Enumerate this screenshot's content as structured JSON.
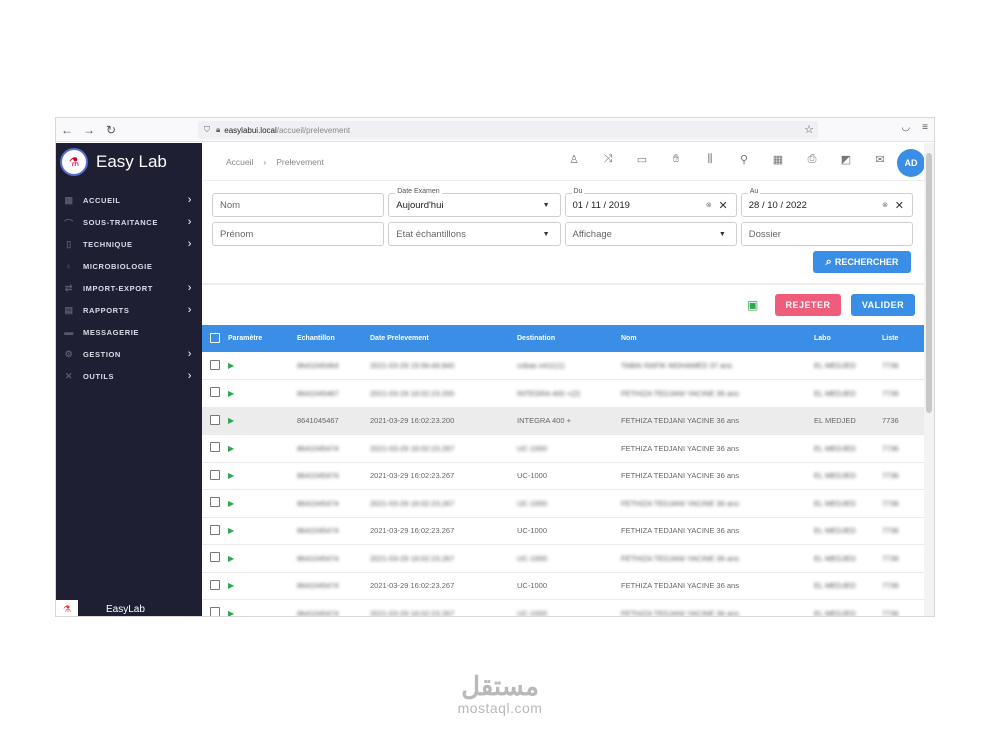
{
  "browser": {
    "url_host": "easylabui.local",
    "url_path": "/accueil/prelevement"
  },
  "sidebar": {
    "app_name": "Easy Lab",
    "items": [
      {
        "label": "ACCUEIL",
        "icon": "grid-icon",
        "chevron": true
      },
      {
        "label": "SOUS-TRAITANCE",
        "icon": "handshake-icon",
        "chevron": true
      },
      {
        "label": "TECHNIQUE",
        "icon": "flask-icon",
        "chevron": true
      },
      {
        "label": "MICROBIOLOGIE",
        "icon": "microscope-icon",
        "chevron": false
      },
      {
        "label": "IMPORT-EXPORT",
        "icon": "transfer-icon",
        "chevron": true
      },
      {
        "label": "RAPPORTS",
        "icon": "report-icon",
        "chevron": true
      },
      {
        "label": "MESSAGERIE",
        "icon": "message-icon",
        "chevron": false
      },
      {
        "label": "GESTION",
        "icon": "gear-icon",
        "chevron": true
      },
      {
        "label": "OUTILS",
        "icon": "tools-icon",
        "chevron": true
      }
    ],
    "footer_label": "EasyLab"
  },
  "header": {
    "breadcrumb": [
      "Accueil",
      "Prelevement"
    ],
    "avatar_initials": "AD"
  },
  "filters": {
    "nom_placeholder": "Nom",
    "date_examen_label": "Date Examen",
    "date_examen_value": "Aujourd'hui",
    "du_label": "Du",
    "du_value": "01 / 11 / 2019",
    "au_label": "Au",
    "au_value": "28 / 10 / 2022",
    "prenom_placeholder": "Prénom",
    "etat_placeholder": "Etat échantillons",
    "affichage_placeholder": "Affichage",
    "dossier_placeholder": "Dossier",
    "search_label": "RECHERCHER"
  },
  "actions": {
    "reject_label": "REJETER",
    "validate_label": "VALIDER"
  },
  "table": {
    "columns": [
      "Paramètre",
      "Echantillon",
      "Date Prelevement",
      "Destination",
      "Nom",
      "Labo",
      "Liste"
    ],
    "rows": [
      {
        "echantillon": "8641045464",
        "date": "2021-03-29 15:56:49.840",
        "destination": "cobas e411(1)",
        "nom": "TABAI RAFIK MOHAMED 37 ans",
        "labo": "EL MEDJED",
        "liste": "7736"
      },
      {
        "echantillon": "8641045467",
        "date": "2021-03-29 16:02:23.200",
        "destination": "INTEGRA 400 +(2)",
        "nom": "FETHIZA TEDJANI YACINE 36 ans",
        "labo": "EL MEDJED",
        "liste": "7736"
      },
      {
        "echantillon": "8641045467",
        "date": "2021-03-29 16:02:23.200",
        "destination": "INTEGRA 400 +",
        "nom": "FETHIZA TEDJANI YACINE 36 ans",
        "labo": "EL MEDJED",
        "liste": "7736"
      },
      {
        "echantillon": "8641045474",
        "date": "2021-03-29 16:02:23.267",
        "destination": "UC-1000",
        "nom": "FETHIZA TEDJANI YACINE 36 ans",
        "labo": "EL MEDJED",
        "liste": "7736"
      },
      {
        "echantillon": "8641045474",
        "date": "2021-03-29 16:02:23.267",
        "destination": "UC-1000",
        "nom": "FETHIZA TEDJANI YACINE 36 ans",
        "labo": "EL MEDJED",
        "liste": "7736"
      },
      {
        "echantillon": "8641045474",
        "date": "2021-03-29 16:02:23.267",
        "destination": "UC-1000",
        "nom": "FETHIZA TEDJANI YACINE 36 ans",
        "labo": "EL MEDJED",
        "liste": "7736"
      },
      {
        "echantillon": "8641045474",
        "date": "2021-03-29 16:02:23.267",
        "destination": "UC-1000",
        "nom": "FETHIZA TEDJANI YACINE 36 ans",
        "labo": "EL MEDJED",
        "liste": "7736"
      },
      {
        "echantillon": "8641045474",
        "date": "2021-03-29 16:02:23.267",
        "destination": "UC-1000",
        "nom": "FETHIZA TEDJANI YACINE 36 ans",
        "labo": "EL MEDJED",
        "liste": "7736"
      },
      {
        "echantillon": "8641045474",
        "date": "2021-03-29 16:02:23.267",
        "destination": "UC-1000",
        "nom": "FETHIZA TEDJANI YACINE 36 ans",
        "labo": "EL MEDJED",
        "liste": "7736"
      },
      {
        "echantillon": "8641045474",
        "date": "2021-03-29 16:02:23.267",
        "destination": "UC-1000",
        "nom": "FETHIZA TEDJANI YACINE 36 ans",
        "labo": "EL MEDJED",
        "liste": "7736"
      }
    ]
  },
  "watermark": {
    "arabic": "مستقل",
    "latin": "mostaql.com"
  },
  "colors": {
    "sidebar_bg": "#1f1f33",
    "accent": "#3a8ee6",
    "reject": "#f05d7a",
    "status_green": "#2ea84b"
  }
}
